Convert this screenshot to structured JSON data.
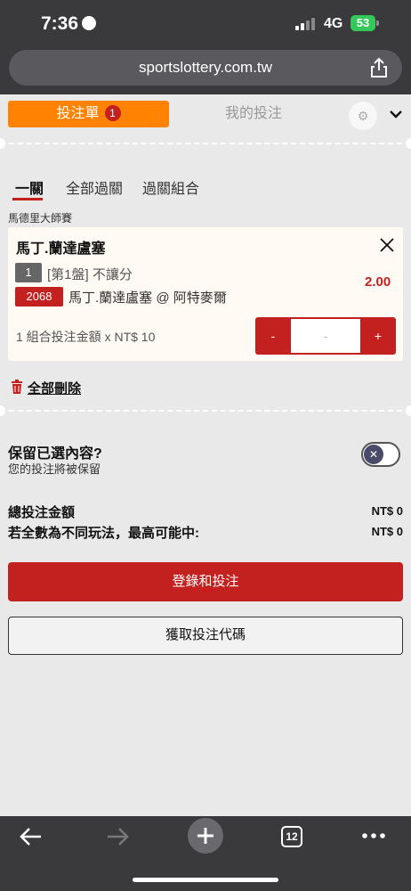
{
  "status_bar": {
    "time": "7:36",
    "network": "4G",
    "battery": "53"
  },
  "browser": {
    "url": "sportslottery.com.tw",
    "tab_count": "12"
  },
  "header": {
    "betslip_tab": "投注單",
    "betslip_count": "1",
    "my_bets_tab": "我的投注"
  },
  "sub_tabs": [
    "一關",
    "全部過關",
    "過關組合"
  ],
  "league": "馬德里大師賽",
  "bet_card": {
    "title": "馬丁.蘭達盧塞",
    "market_num": "1",
    "market": "[第1盤] 不讓分",
    "event_code": "2068",
    "selection": "馬丁.蘭達盧塞 @ 阿特麥爾",
    "odds": "2.00",
    "stake_label": "1 組合投注金額 x NT$ 10",
    "minus": "-",
    "stake_value": "-",
    "plus": "+"
  },
  "delete_all": "全部刪除",
  "keep_selection": {
    "title": "保留已選內容?",
    "subtitle": "您的投注將被保留",
    "toggle_on": false
  },
  "summary": {
    "total_label": "總投注金額",
    "total_value": "NT$ 0",
    "max_win_label": "若全數為不同玩法，最高可能中:",
    "max_win_value": "NT$ 0"
  },
  "buttons": {
    "login_bet": "登錄和投注",
    "get_code": "獲取投注代碼"
  },
  "colors": {
    "brand_orange": "#ff8200",
    "brand_red": "#c32020",
    "chrome": "#3a3a3c"
  }
}
